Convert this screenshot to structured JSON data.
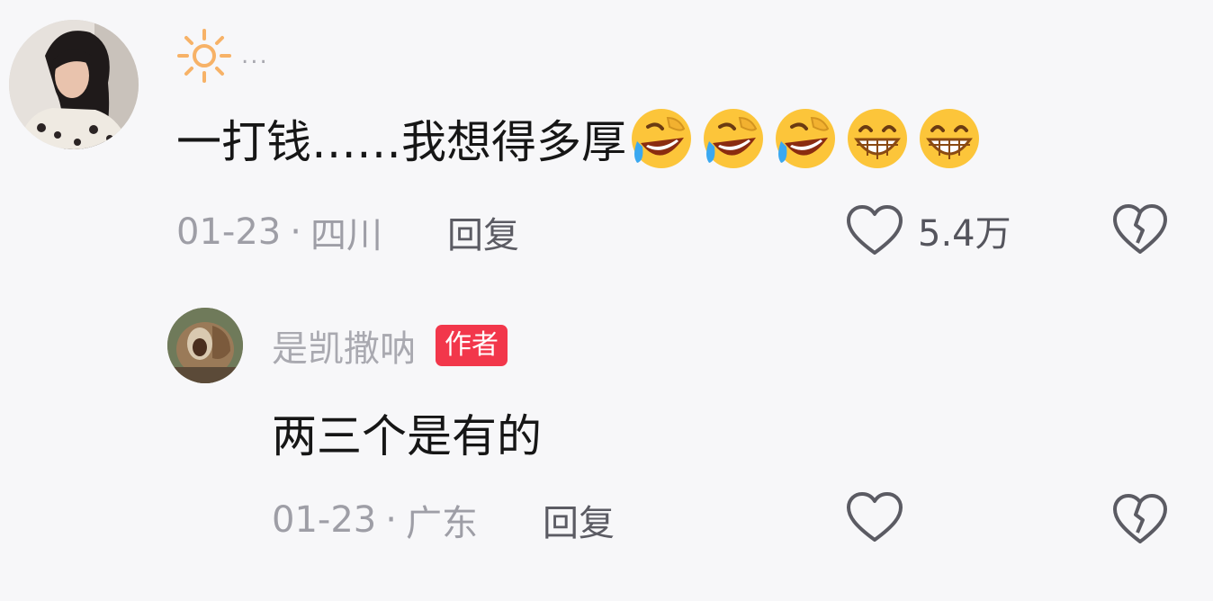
{
  "comment": {
    "username": "...",
    "text": "一打钱……我想得多厚",
    "emojis": [
      "rofl-emoji",
      "rofl-emoji",
      "rofl-emoji",
      "grin-emoji",
      "grin-emoji"
    ],
    "date": "01-23",
    "separator": "·",
    "location": "四川",
    "reply_label": "回复",
    "like_count": "5.4万"
  },
  "reply": {
    "username": "是凯撒呐",
    "badge": "作者",
    "text": "两三个是有的",
    "date": "01-23",
    "separator": "·",
    "location": "广东",
    "reply_label": "回复"
  },
  "icons": {
    "username_prefix": "sun-icon",
    "like": "heart-outline-icon",
    "dislike": "broken-heart-icon"
  },
  "colors": {
    "background": "#f7f7f9",
    "badge": "#f2374b",
    "muted_text": "#9e9ea6",
    "emoji_yellow": "#fcc53a"
  }
}
